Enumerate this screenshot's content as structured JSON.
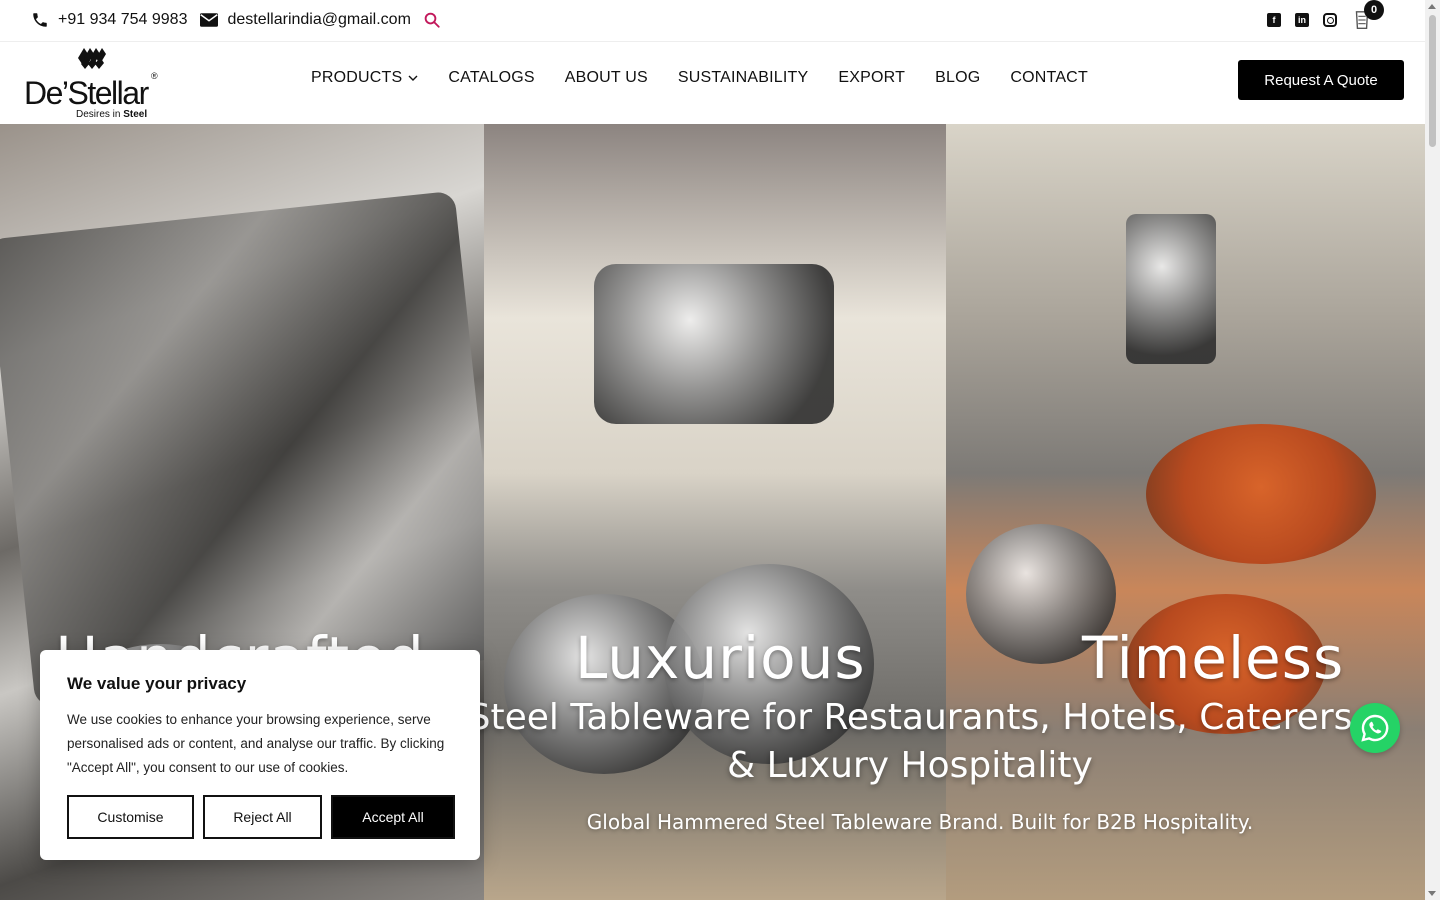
{
  "topbar": {
    "phone": "+91 934 754 9983",
    "email": "destellarindia@gmail.com",
    "icons": {
      "phone": "phone-icon",
      "email": "envelope-icon",
      "search": "search-icon"
    },
    "socials": [
      {
        "name": "facebook-icon",
        "label": "f"
      },
      {
        "name": "linkedin-icon",
        "label": "in"
      },
      {
        "name": "instagram-icon",
        "label": ""
      }
    ],
    "cart_count": "0"
  },
  "header": {
    "logo_name": "De’Stellar",
    "logo_tagline": "Desires in Steel",
    "nav": [
      {
        "label": "PRODUCTS",
        "has_dropdown": true
      },
      {
        "label": "CATALOGS"
      },
      {
        "label": "ABOUT US"
      },
      {
        "label": "SUSTAINABILITY"
      },
      {
        "label": "EXPORT"
      },
      {
        "label": "BLOG"
      },
      {
        "label": "CONTACT"
      }
    ],
    "quote_button": "Request A Quote"
  },
  "hero": {
    "words": [
      "Handcrafted",
      "Luxurious",
      "Timeless"
    ],
    "title_line1": "Steel Tableware for Restaurants, Hotels, Caterers",
    "title_line2": "& Luxury Hospitality",
    "subtitle": "Global Hammered Steel Tableware Brand. Built for B2B Hospitality."
  },
  "cookie": {
    "title": "We value your privacy",
    "body": "We use cookies to enhance your browsing experience, serve personalised ads or content, and analyse our traffic. By clicking \"Accept All\", you consent to our use of cookies.",
    "customise": "Customise",
    "reject": "Reject All",
    "accept": "Accept All"
  },
  "colors": {
    "accent_search": "#c2185b",
    "whatsapp": "#25d366",
    "button_dark": "#000000"
  }
}
